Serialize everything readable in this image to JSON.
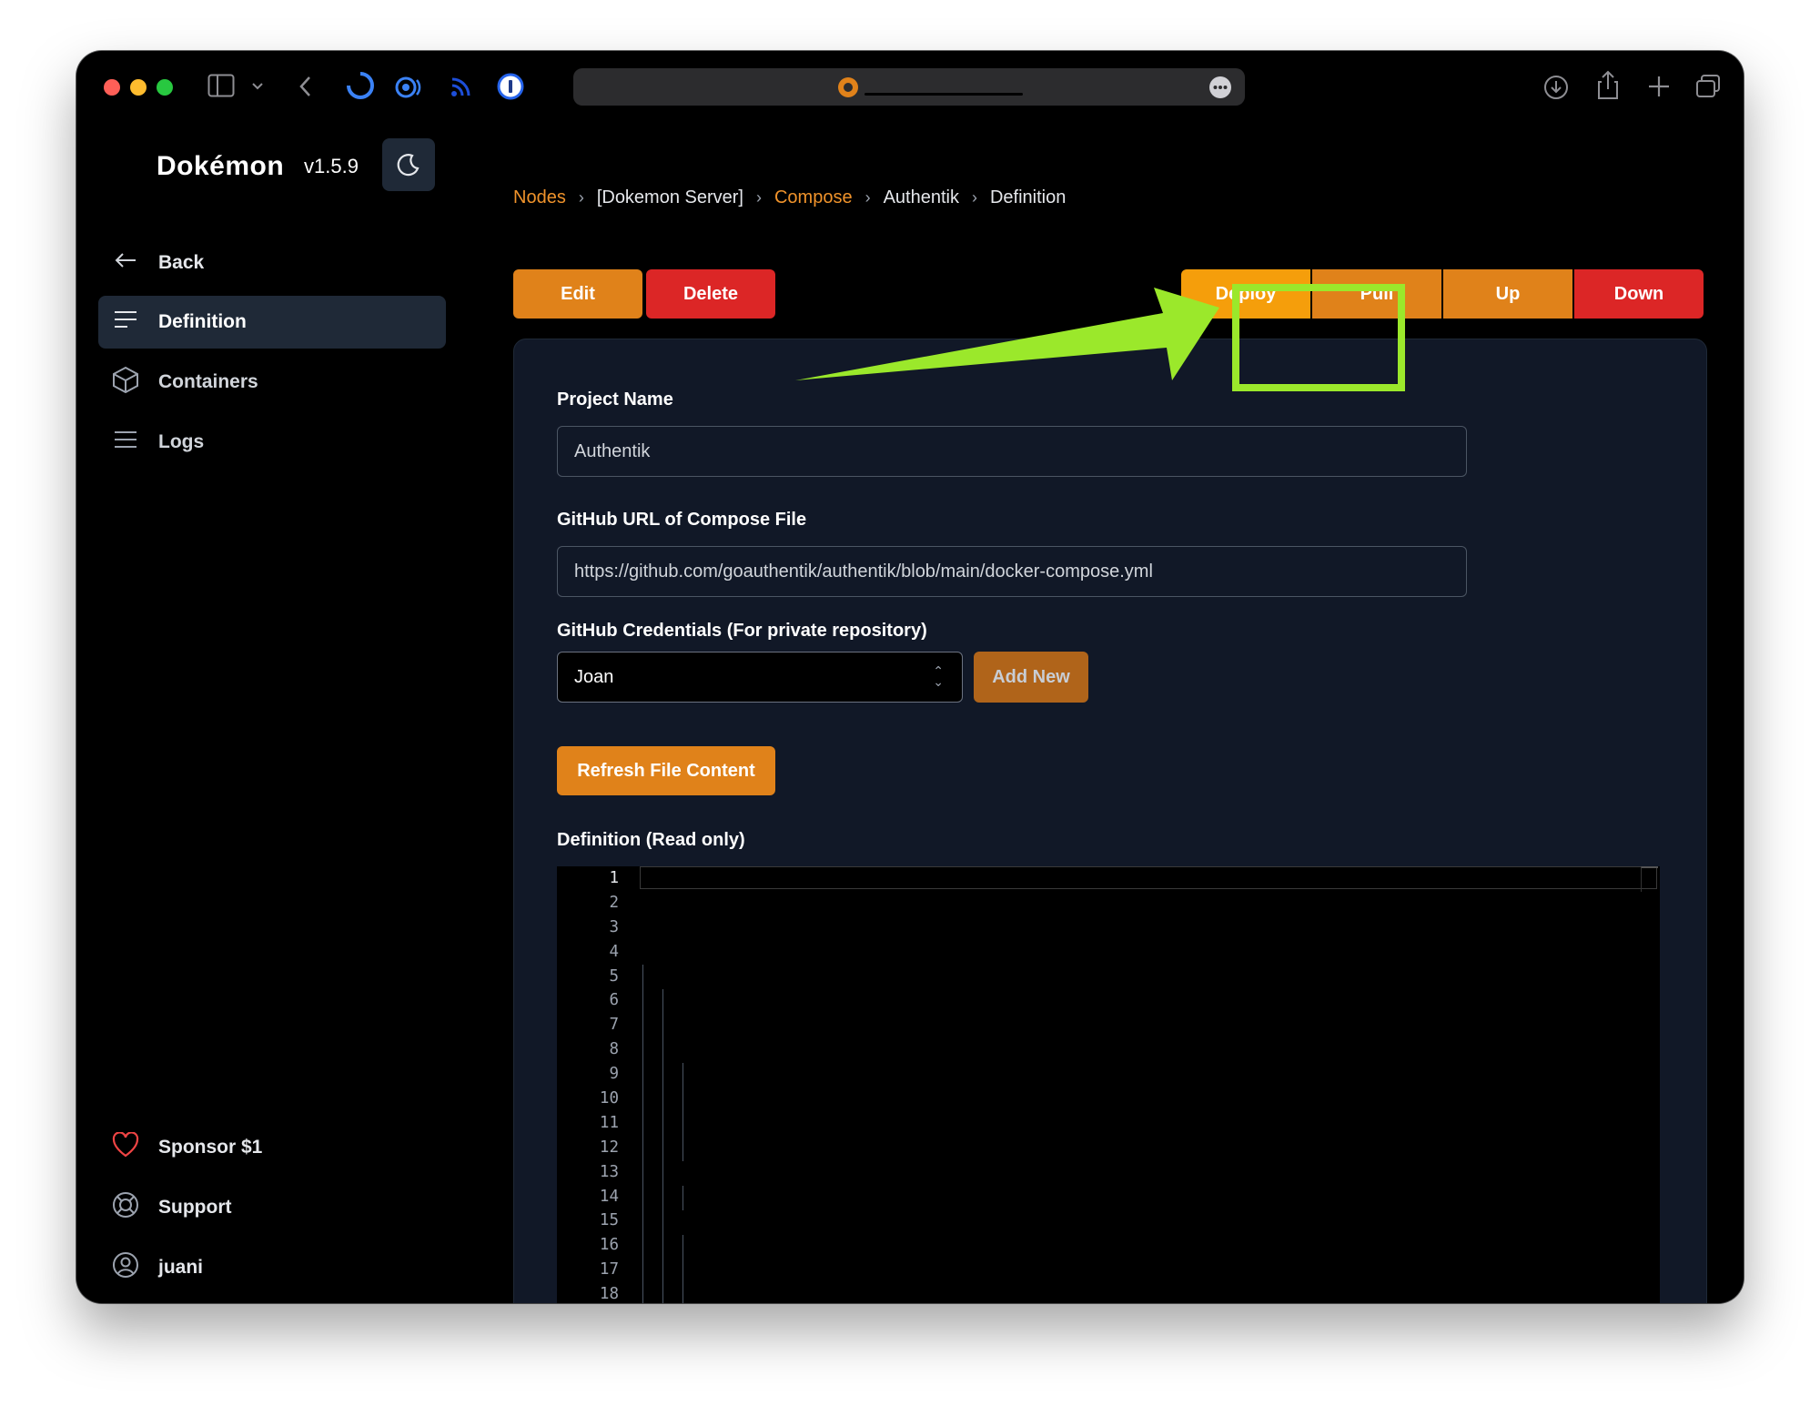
{
  "brand": {
    "name": "Dokémon",
    "version": "v1.5.9"
  },
  "sidebar": {
    "items": [
      {
        "label": "Back",
        "icon": "arrow-left-icon"
      },
      {
        "label": "Definition",
        "icon": "lines-icon"
      },
      {
        "label": "Containers",
        "icon": "cube-icon"
      },
      {
        "label": "Logs",
        "icon": "list-icon"
      }
    ],
    "footer": [
      {
        "label": "Sponsor $1",
        "icon": "heart-icon"
      },
      {
        "label": "Support",
        "icon": "lifebuoy-icon"
      },
      {
        "label": "juani",
        "icon": "user-circle-icon"
      }
    ]
  },
  "breadcrumb": {
    "nodes": "Nodes",
    "server": "[Dokemon Server]",
    "compose": "Compose",
    "project": "Authentik",
    "page": "Definition"
  },
  "actions": {
    "edit": "Edit",
    "delete": "Delete",
    "deploy": "Deploy",
    "pull": "Pull",
    "up": "Up",
    "down": "Down"
  },
  "form": {
    "project_name_label": "Project Name",
    "project_name_value": "Authentik",
    "github_url_label": "GitHub URL of Compose File",
    "github_url_value": "https://github.com/goauthentik/authentik/blob/main/docker-compose.yml",
    "credentials_label": "GitHub Credentials (For private repository)",
    "credentials_value": "Joan",
    "add_new": "Add New",
    "refresh": "Refresh File Content",
    "definition_label": "Definition (Read only)"
  },
  "editor": {
    "line_numbers": [
      "1",
      "2",
      "3",
      "4",
      "5",
      "6",
      "7",
      "8",
      "9",
      "10",
      "11",
      "12",
      "13",
      "14",
      "15",
      "16",
      "17",
      "18"
    ]
  },
  "colors": {
    "accent": "#e0821a",
    "danger": "#dc2626",
    "highlight": "#9be82b"
  }
}
